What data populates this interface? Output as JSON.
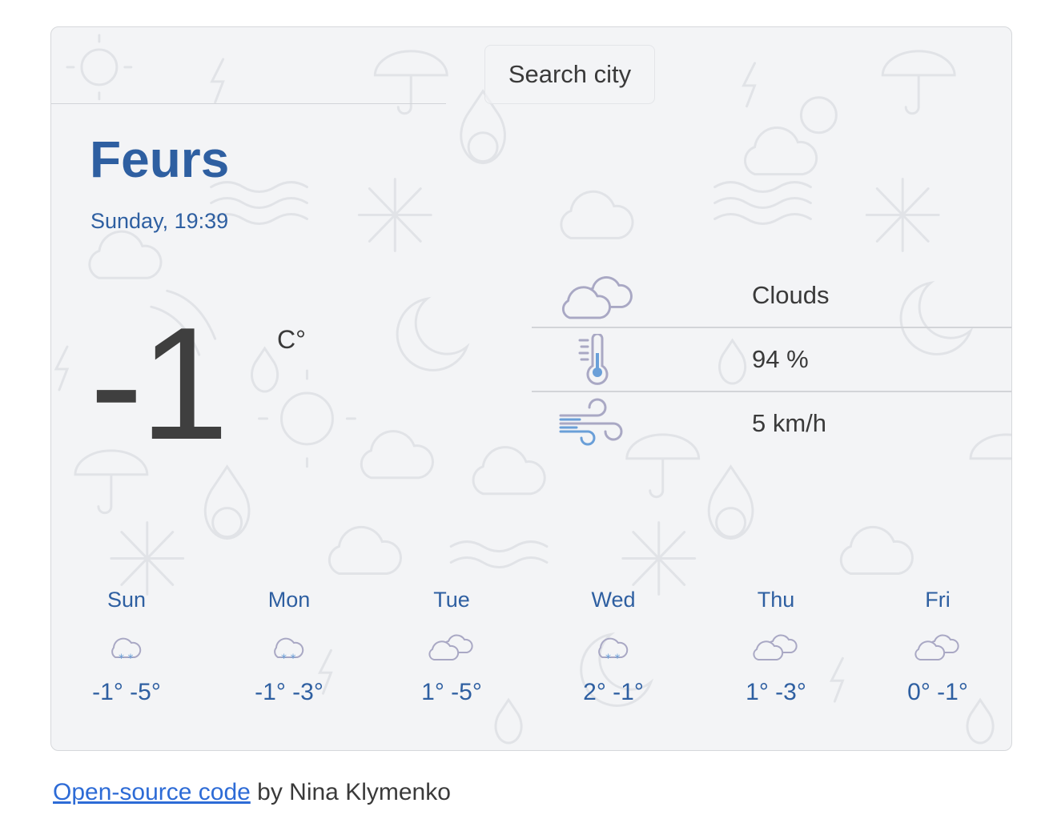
{
  "search": {
    "label": "Search city"
  },
  "current": {
    "city": "Feurs",
    "datetime": "Sunday, 19:39",
    "temperature": "-1",
    "unit": "C°",
    "condition": "Clouds",
    "humidity": "94 %",
    "wind": "5 km/h"
  },
  "forecast": [
    {
      "day": "Sun",
      "icon": "snow-icon",
      "temps": "-1° -5°"
    },
    {
      "day": "Mon",
      "icon": "snow-icon",
      "temps": "-1° -3°"
    },
    {
      "day": "Tue",
      "icon": "clouds-icon",
      "temps": "1° -5°"
    },
    {
      "day": "Wed",
      "icon": "snow-icon",
      "temps": "2° -1°"
    },
    {
      "day": "Thu",
      "icon": "clouds-icon",
      "temps": "1° -3°"
    },
    {
      "day": "Fri",
      "icon": "clouds-icon",
      "temps": "0° -1°"
    }
  ],
  "footer": {
    "link_text": "Open-source code",
    "suffix": " by Nina Klymenko"
  },
  "colors": {
    "accent": "#2e5fa1",
    "text": "#3a3a3a",
    "card_bg": "#f3f4f6",
    "link": "#2d6bd6"
  }
}
